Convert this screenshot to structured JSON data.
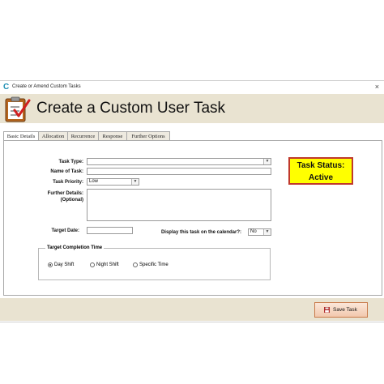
{
  "window": {
    "title": "Create or Amend Custom Tasks",
    "close_glyph": "×"
  },
  "header": {
    "title": "Create a Custom User Task"
  },
  "tabs": [
    {
      "label": "Basic Details"
    },
    {
      "label": "Allocation"
    },
    {
      "label": "Recurrence"
    },
    {
      "label": "Response"
    },
    {
      "label": "Further Options"
    }
  ],
  "form": {
    "task_type_label": "Task Type:",
    "task_type_value": "",
    "name_label": "Name of Task:",
    "name_value": "",
    "priority_label": "Task Priority:",
    "priority_value": "Low",
    "details_label_1": "Further Details:",
    "details_label_2": "(Optional)",
    "details_value": "",
    "target_date_label": "Target Date:",
    "target_date_value": "",
    "calendar_label": "Display this task on the calendar?:",
    "calendar_value": "No"
  },
  "status": {
    "line1": "Task Status:",
    "line2": "Active"
  },
  "completion": {
    "legend": "Target Completion Time",
    "options": [
      {
        "label": "Day Shift",
        "selected": true
      },
      {
        "label": "Night Shift",
        "selected": false
      },
      {
        "label": "Specific Time",
        "selected": false
      }
    ]
  },
  "footer": {
    "save_label": "Save Task"
  },
  "colors": {
    "header_bg": "#e9e3d1",
    "status_bg": "#ffff00",
    "status_border": "#c0392b",
    "accent": "#1f8fb3"
  }
}
